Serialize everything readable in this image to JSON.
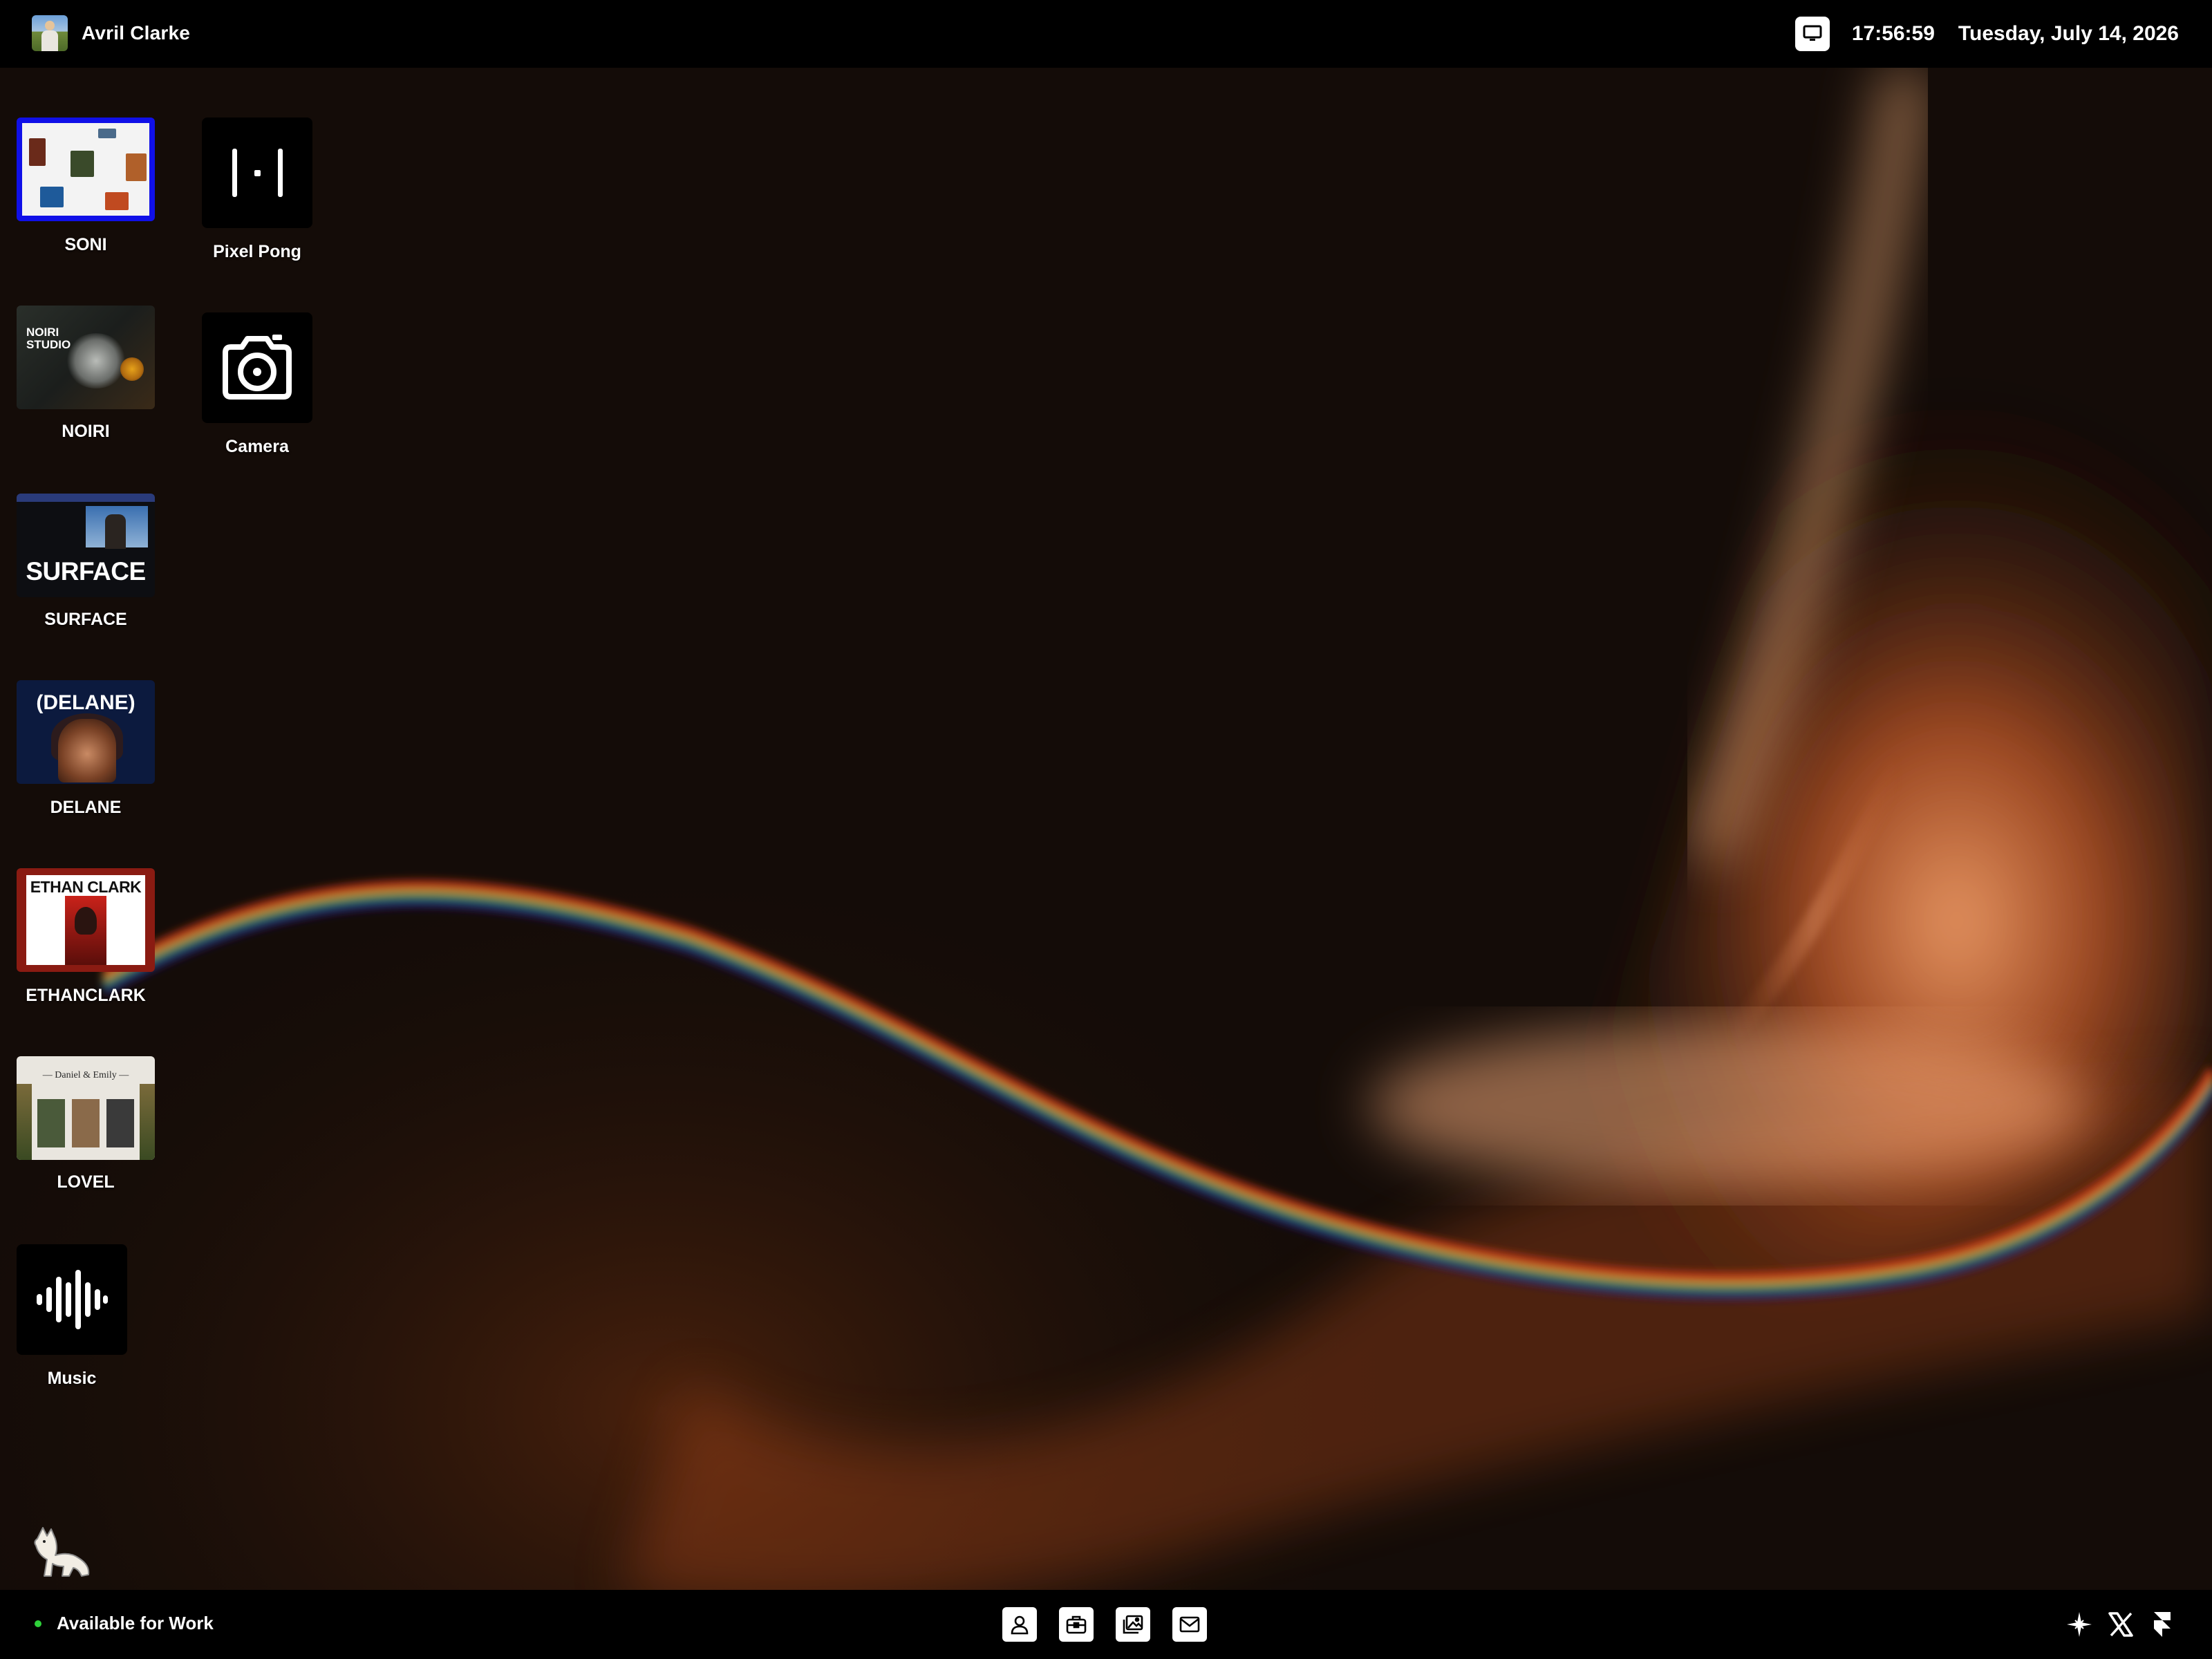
{
  "topbar": {
    "user_name": "Avril Clarke",
    "time": "17:56:59",
    "date": "Tuesday, July 14, 2026"
  },
  "desktop": {
    "project_icons": [
      {
        "label": "SONI",
        "thumb_icon": "soni-site-preview"
      },
      {
        "label": "NOIRI",
        "thumb_icon": "noiri-site-preview",
        "thumb_text": "NOIRI STUDIO"
      },
      {
        "label": "SURFACE",
        "thumb_icon": "surface-site-preview",
        "thumb_text": "SURFACE"
      },
      {
        "label": "DELANE",
        "thumb_icon": "delane-site-preview",
        "thumb_text": "(DELANE)"
      },
      {
        "label": "ETHANCLARK",
        "thumb_icon": "ethanclark-site-preview",
        "thumb_text": "ETHAN CLARK"
      },
      {
        "label": "LOVEL",
        "thumb_icon": "lovel-site-preview",
        "thumb_text": "— Daniel & Emily —"
      }
    ],
    "apps": [
      {
        "label": "Pixel Pong",
        "icon": "pong-icon"
      },
      {
        "label": "Camera",
        "icon": "camera-icon"
      },
      {
        "label": "Music",
        "icon": "waveform-icon"
      }
    ]
  },
  "bottombar": {
    "status_text": "Available for Work",
    "status_color": "#2ed13a",
    "dock_icons": [
      "user-icon",
      "briefcase-icon",
      "gallery-icon",
      "mail-icon"
    ],
    "social_icons": [
      "sparkle-icon",
      "x-logo-icon",
      "framer-logo-icon"
    ]
  },
  "colors": {
    "bars": "#000000",
    "selection_border": "#1010e8",
    "wallpaper_glow": "#e0763a"
  }
}
